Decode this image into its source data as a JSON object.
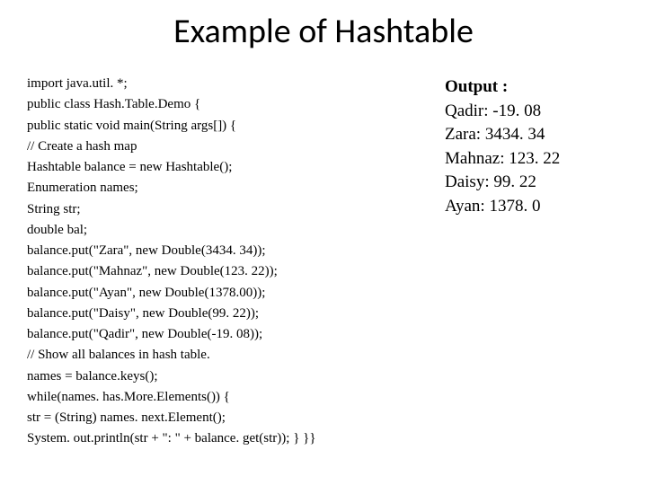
{
  "title": "Example of Hashtable",
  "code": {
    "l0": "import java.util. *;",
    "l1": "public class Hash.Table.Demo {",
    "l2": "public static void main(String args[]) {",
    "l3": " // Create a hash map",
    "l4": "Hashtable balance = new Hashtable();",
    "l5": "Enumeration names;",
    "l6": "String str;",
    "l7": "double bal;",
    "l8": "balance.put(\"Zara\", new Double(3434. 34));",
    "l9": "balance.put(\"Mahnaz\", new Double(123. 22));",
    "l10": "balance.put(\"Ayan\", new Double(1378.00));",
    "l11": " balance.put(\"Daisy\", new Double(99. 22));",
    "l12": "balance.put(\"Qadir\", new Double(-19. 08));",
    "l13": "// Show all balances in hash table.",
    "l14": "names = balance.keys();",
    "l15": "while(names. has.More.Elements()) {",
    "l16": " str = (String) names. next.Element();",
    "l17": "System. out.println(str + \": \" + balance. get(str)); } }}"
  },
  "output": {
    "heading": "Output :",
    "r0": "Qadir: -19. 08",
    "r1": "Zara: 3434. 34",
    "r2": "Mahnaz: 123. 22",
    "r3": "Daisy: 99. 22",
    "r4": "Ayan: 1378. 0"
  }
}
